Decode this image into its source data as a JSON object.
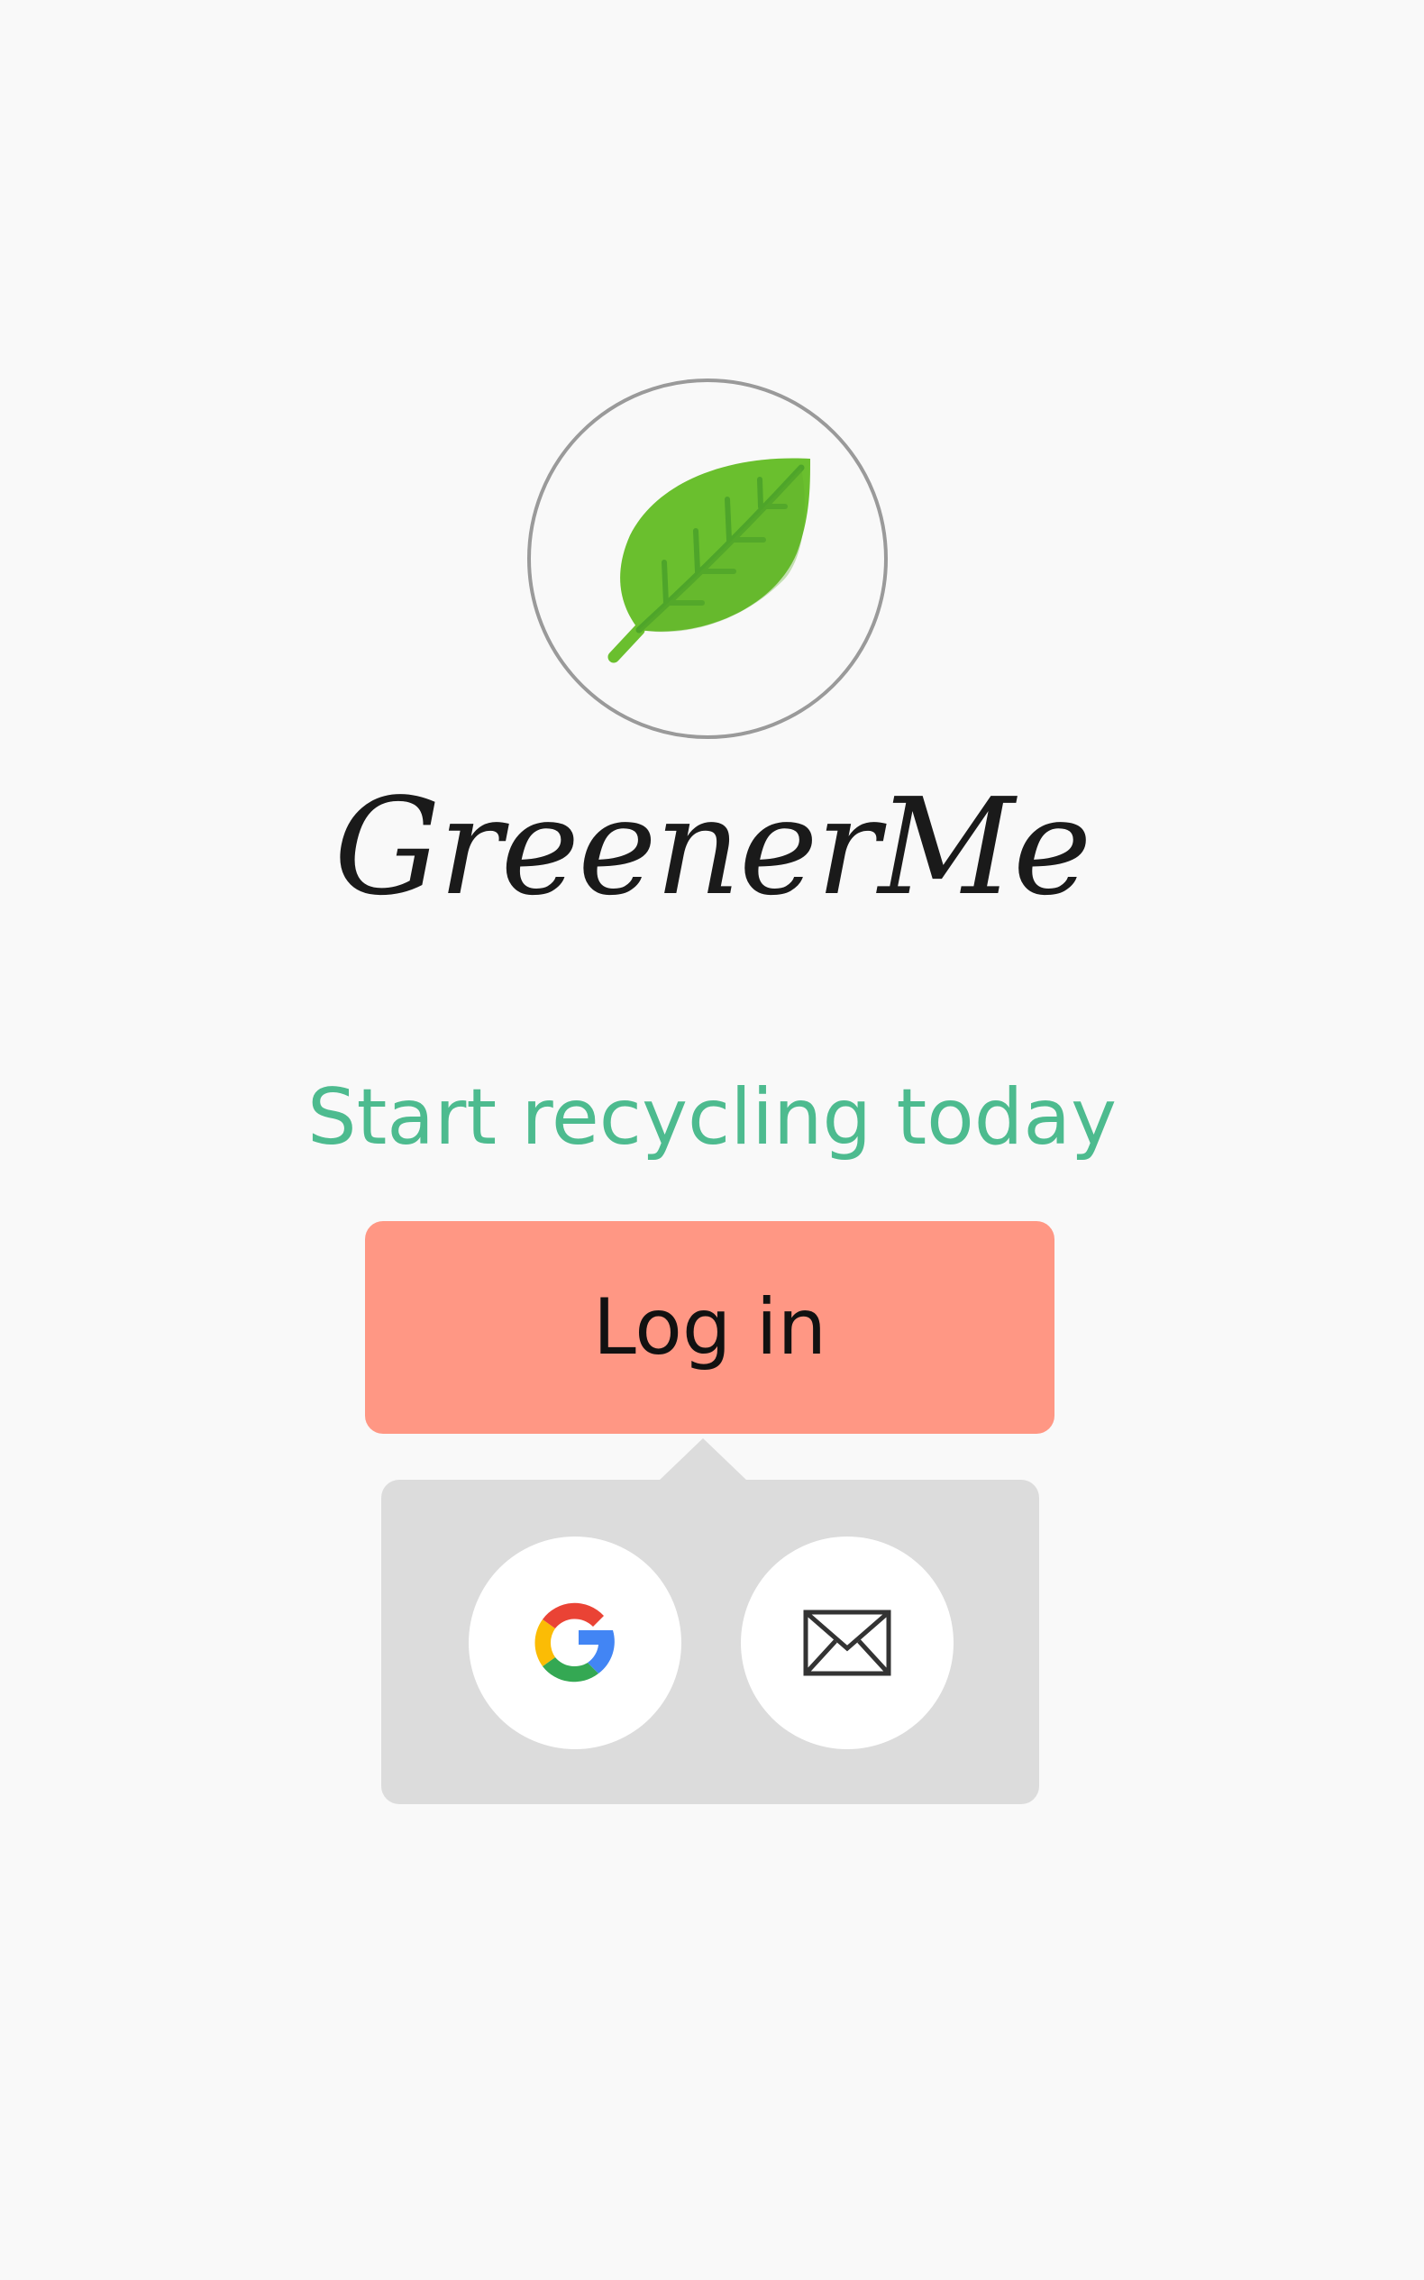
{
  "brand": {
    "name": "GreenerMe",
    "logo_icon": "leaf-icon",
    "leaf_color": "#6abf2e",
    "leaf_vein_color": "#4ea52a"
  },
  "tagline": {
    "text": "Start recycling today",
    "color": "#4dbb8f"
  },
  "login": {
    "label": "Log in",
    "color": "#ff9784"
  },
  "auth_options": [
    {
      "name": "google-icon",
      "provider": "Google"
    },
    {
      "name": "mail-icon",
      "provider": "Email"
    }
  ],
  "background_color": "#f9f9f9"
}
